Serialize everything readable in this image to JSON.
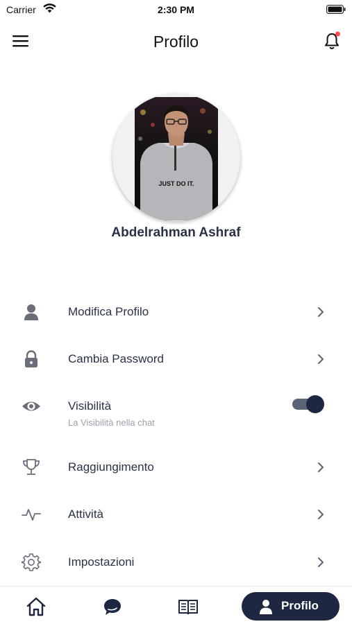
{
  "status_bar": {
    "carrier": "Carrier",
    "time": "2:30 PM"
  },
  "header": {
    "title": "Profilo",
    "notification_dot_color": "#ff4d4d"
  },
  "profile": {
    "name": "Abdelrahman Ashraf",
    "shirt_text": "JUST DO IT."
  },
  "menu": {
    "edit_profile": "Modifica Profilo",
    "change_password": "Cambia Password",
    "visibility": "Visibilità",
    "visibility_sub": "La Visibilità nella chat",
    "visibility_enabled": true,
    "achievement": "Raggiungimento",
    "activity": "Attività",
    "settings": "Impostazioni"
  },
  "tabs": {
    "items": [
      "home-icon",
      "chat-icon",
      "book-icon",
      "user-icon"
    ],
    "active_label": "Profilo"
  },
  "colors": {
    "accent": "#1d2742",
    "text": "#2a3246",
    "muted": "#9aa0aa",
    "icon": "#5f6370"
  }
}
